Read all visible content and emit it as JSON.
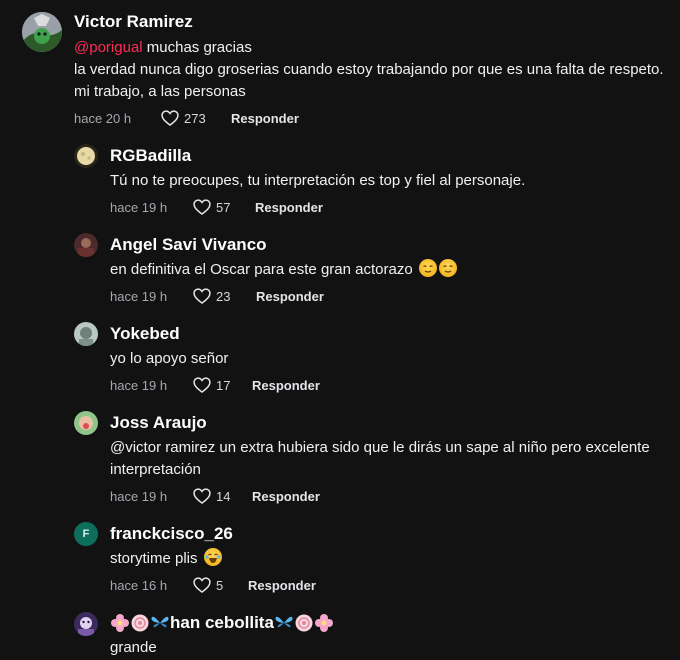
{
  "comments": [
    {
      "username": "Victor Ramirez",
      "mention": "@porigual",
      "line1_rest": " muchas gracias",
      "text": "la verdad nunca digo groserias cuando estoy trabajando por que es una falta de respeto. mi trabajo, a las personas",
      "time": "hace 20 h",
      "likes": "273",
      "reply_label": "Responder"
    },
    {
      "username": "RGBadilla",
      "text": "Tú no te preocupes, tu interpretación es top y fiel al personaje.",
      "time": "hace 19 h",
      "likes": "57",
      "reply_label": "Responder"
    },
    {
      "username": "Angel Savi Vivanco",
      "text": "en definitiva el Oscar para este gran actorazo",
      "time": "hace 19 h",
      "likes": "23",
      "reply_label": "Responder"
    },
    {
      "username": "Yokebed",
      "text": "yo lo apoyo señor",
      "time": "hace 19 h",
      "likes": "17",
      "reply_label": "Responder"
    },
    {
      "username": "Joss Araujo",
      "text": "@victor ramirez un extra hubiera sido que le dirás un sape al niño pero excelente interpretación",
      "time": "hace 19 h",
      "likes": "14",
      "reply_label": "Responder"
    },
    {
      "username": "franckcisco_26",
      "avatar_letter": "F",
      "text": "storytime plis",
      "time": "hace 16 h",
      "likes": "5",
      "reply_label": "Responder"
    },
    {
      "username": "han cebollita",
      "text": "grande"
    }
  ],
  "colors": {
    "background": "#121212",
    "mention": "#fe2c55",
    "muted": "#a8a8ad",
    "avatar_f": "#0e6e5c"
  }
}
